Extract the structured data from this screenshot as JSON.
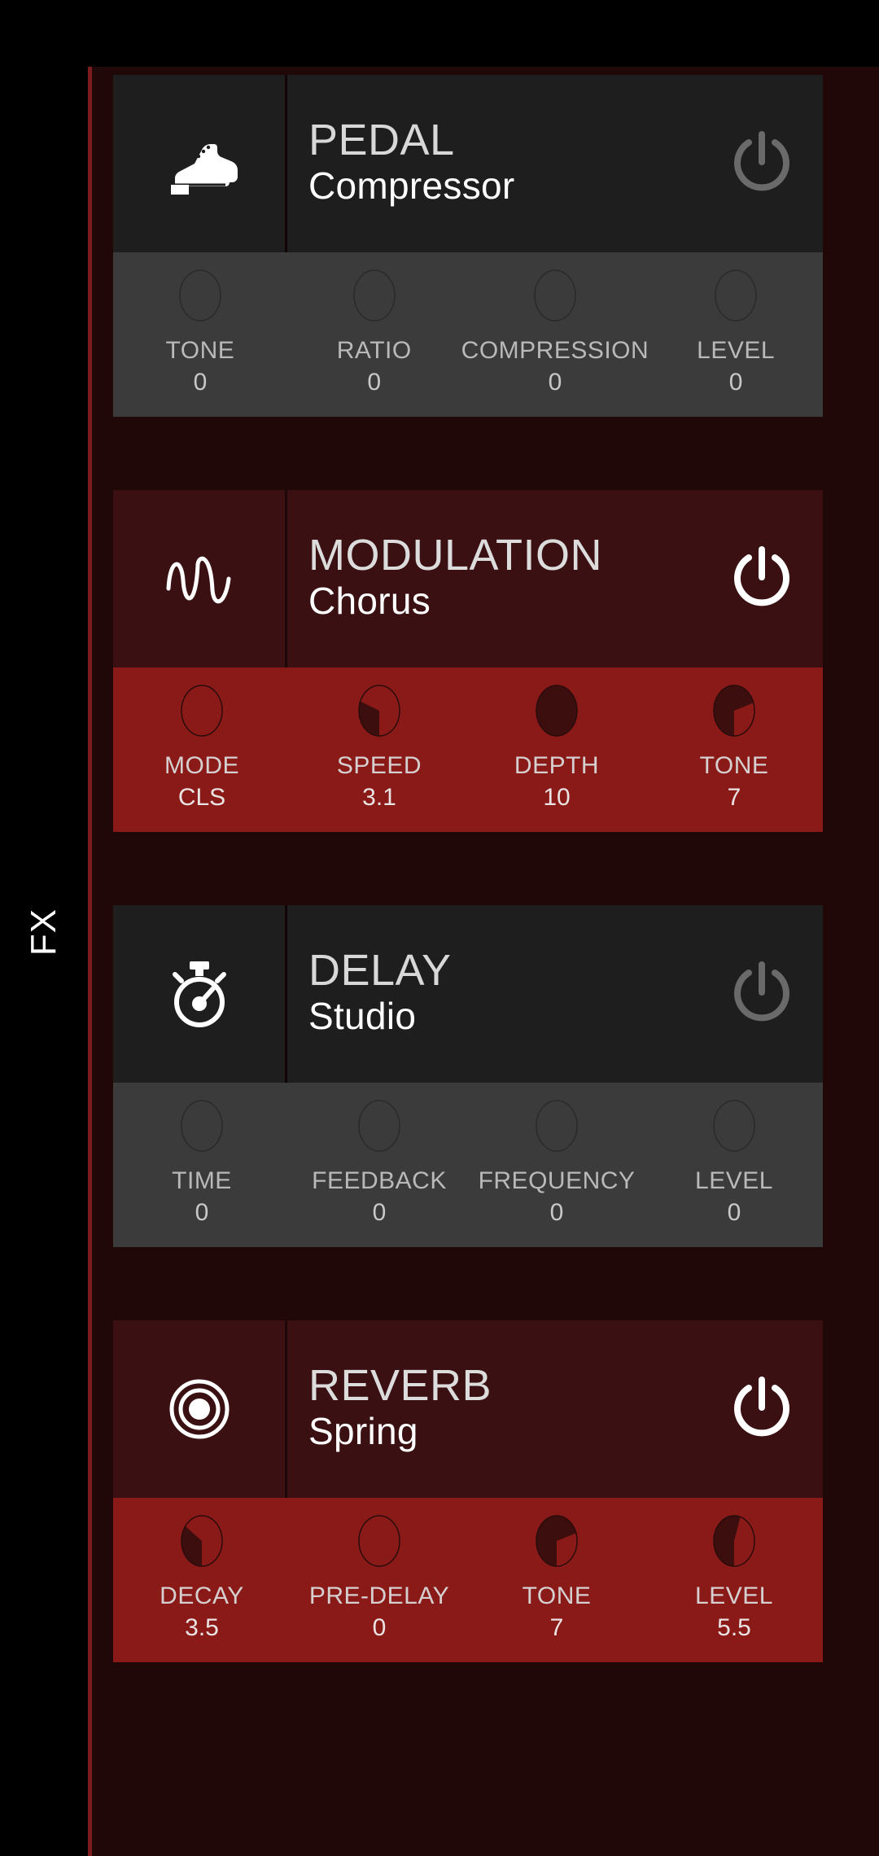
{
  "rail": {
    "label": "FX"
  },
  "colors": {
    "page_background": "#000000",
    "panel_background": "#200808",
    "accent_line": "#7d1c1c",
    "header_off": "#1e1e1e",
    "header_on": "#3a1012",
    "knobs_off": "#3b3b3b",
    "knobs_on": "#8a1a18",
    "knob_fill": "#3c0e0e",
    "power_on": "#ffffff",
    "power_off": "#6a6a6a",
    "title_text": "#d8d8d8",
    "preset_text": "#ffffff"
  },
  "effects": [
    {
      "name": "PEDAL",
      "preset": "Compressor",
      "icon": "sneaker-icon",
      "enabled": false,
      "power_label": "power-icon",
      "knobs": [
        {
          "label": "TONE",
          "value": "0",
          "fill": 0
        },
        {
          "label": "RATIO",
          "value": "0",
          "fill": 0
        },
        {
          "label": "COMPRESSION",
          "value": "0",
          "fill": 0
        },
        {
          "label": "LEVEL",
          "value": "0",
          "fill": 0
        }
      ]
    },
    {
      "name": "MODULATION",
      "preset": "Chorus",
      "icon": "waveform-icon",
      "enabled": true,
      "power_label": "power-icon",
      "knobs": [
        {
          "label": "MODE",
          "value": "CLS",
          "fill": 0
        },
        {
          "label": "SPEED",
          "value": "3.1",
          "fill": 0.31
        },
        {
          "label": "DEPTH",
          "value": "10",
          "fill": 1
        },
        {
          "label": "TONE",
          "value": "7",
          "fill": 0.7
        }
      ]
    },
    {
      "name": "DELAY",
      "preset": "Studio",
      "icon": "stopwatch-icon",
      "enabled": false,
      "power_label": "power-icon",
      "knobs": [
        {
          "label": "TIME",
          "value": "0",
          "fill": 0
        },
        {
          "label": "FEEDBACK",
          "value": "0",
          "fill": 0
        },
        {
          "label": "FREQUENCY",
          "value": "0",
          "fill": 0
        },
        {
          "label": "LEVEL",
          "value": "0",
          "fill": 0
        }
      ]
    },
    {
      "name": "REVERB",
      "preset": "Spring",
      "icon": "concentric-circles-icon",
      "enabled": true,
      "power_label": "power-icon",
      "knobs": [
        {
          "label": "DECAY",
          "value": "3.5",
          "fill": 0.35
        },
        {
          "label": "PRE-DELAY",
          "value": "0",
          "fill": 0
        },
        {
          "label": "TONE",
          "value": "7",
          "fill": 0.7
        },
        {
          "label": "LEVEL",
          "value": "5.5",
          "fill": 0.55
        }
      ]
    }
  ]
}
